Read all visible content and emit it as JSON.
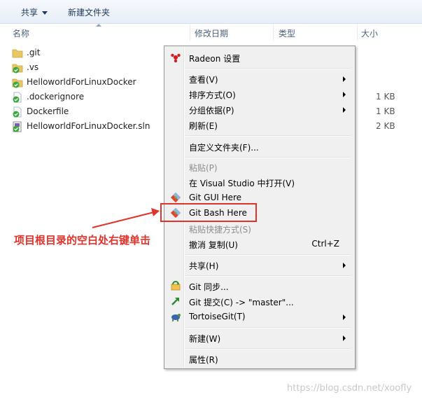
{
  "toolbar": {
    "share": "共享",
    "new_folder": "新建文件夹"
  },
  "columns": {
    "name": "名称",
    "modified": "修改日期",
    "type": "类型",
    "size": "大小"
  },
  "files": [
    {
      "name": ".git",
      "size": "",
      "icon": "folder-icon"
    },
    {
      "name": ".vs",
      "size": "",
      "icon": "git-folder-icon"
    },
    {
      "name": "HelloworldForLinuxDocker",
      "size": "",
      "icon": "git-folder-icon"
    },
    {
      "name": ".dockerignore",
      "size": "1 KB",
      "icon": "git-file-icon"
    },
    {
      "name": "Dockerfile",
      "size": "1 KB",
      "icon": "git-file-icon"
    },
    {
      "name": "HelloworldForLinuxDocker.sln",
      "size": "2 KB",
      "icon": "sln-file-icon"
    }
  ],
  "menu": {
    "radeon": "Radeon 设置",
    "view": "查看(V)",
    "sort": "排序方式(O)",
    "group": "分组依据(P)",
    "refresh": "刷新(E)",
    "customize": "自定义文件夹(F)...",
    "paste": "粘贴(P)",
    "open_vs": "在 Visual Studio 中打开(V)",
    "git_gui": "Git GUI Here",
    "git_bash": "Git Bash Here",
    "paste_shortcut": "粘贴快捷方式(S)",
    "undo_copy": "撤消 复制(U)",
    "undo_shortcut": "Ctrl+Z",
    "share": "共享(H)",
    "git_sync": "Git 同步...",
    "git_commit": "Git 提交(C) -> \"master\"...",
    "tortoise": "TortoiseGit(T)",
    "new": "新建(W)",
    "properties": "属性(R)"
  },
  "annotation": "项目根目录的空白处右键单击",
  "watermark": "https://blog.csdn.net/xoofly",
  "colors": {
    "annotation_red": "#e0332c",
    "menu_bg": "#f0f0f0",
    "toolbar_text": "#1e395b"
  }
}
